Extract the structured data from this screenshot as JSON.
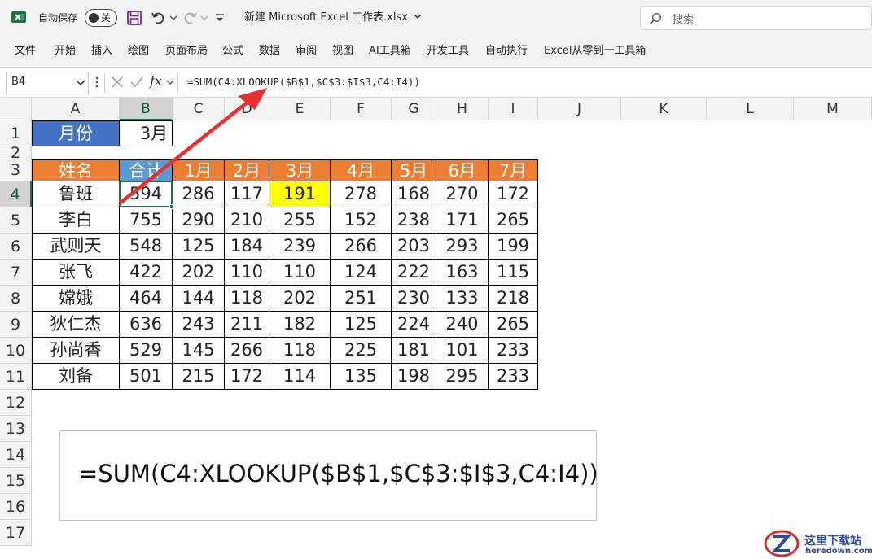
{
  "titlebar": {
    "autosave_label": "自动保存",
    "autosave_state": "关",
    "file_title": "新建 Microsoft Excel 工作表.xlsx",
    "search_placeholder": "搜索"
  },
  "ribbon": {
    "tabs": [
      "文件",
      "开始",
      "插入",
      "绘图",
      "页面布局",
      "公式",
      "数据",
      "审阅",
      "视图",
      "AI工具箱",
      "开发工具",
      "自动执行",
      "Excel从零到一工具箱"
    ]
  },
  "formula_bar": {
    "name_box": "B4",
    "fx_label": "fx",
    "formula": "=SUM(C4:XLOOKUP($B$1,$C$3:$I$3,C4:I4))"
  },
  "sheet": {
    "columns": [
      "A",
      "B",
      "C",
      "D",
      "E",
      "F",
      "G",
      "H",
      "I",
      "J",
      "K",
      "L",
      "M"
    ],
    "rows": [
      "1",
      "2",
      "3",
      "4",
      "5",
      "6",
      "7",
      "8",
      "9",
      "10",
      "11",
      "12",
      "13",
      "14",
      "15",
      "16",
      "17"
    ],
    "selected_cell": "B4",
    "month_label": "月份",
    "month_value": "3月",
    "table_headers": [
      "姓名",
      "合计",
      "1月",
      "2月",
      "3月",
      "4月",
      "5月",
      "6月",
      "7月"
    ],
    "table_rows": [
      [
        "鲁班",
        "594",
        "286",
        "117",
        "191",
        "278",
        "168",
        "270",
        "172"
      ],
      [
        "李白",
        "755",
        "290",
        "210",
        "255",
        "152",
        "238",
        "171",
        "265"
      ],
      [
        "武则天",
        "548",
        "125",
        "184",
        "239",
        "266",
        "203",
        "293",
        "199"
      ],
      [
        "张飞",
        "422",
        "202",
        "110",
        "110",
        "124",
        "222",
        "163",
        "115"
      ],
      [
        "嫦娥",
        "464",
        "144",
        "118",
        "202",
        "251",
        "230",
        "133",
        "218"
      ],
      [
        "狄仁杰",
        "636",
        "243",
        "211",
        "182",
        "125",
        "224",
        "240",
        "265"
      ],
      [
        "孙尚香",
        "529",
        "145",
        "266",
        "118",
        "225",
        "181",
        "101",
        "233"
      ],
      [
        "刘备",
        "501",
        "215",
        "172",
        "114",
        "135",
        "198",
        "295",
        "233"
      ]
    ],
    "formula_callout": "=SUM(C4:XLOOKUP($B$1,$C$3:$I$3,C4:I4))"
  },
  "colors": {
    "header_orange": "#ed7d31",
    "header_blue": "#5b9bd5",
    "month_label_blue": "#4472c4",
    "highlight_yellow": "#ffff00",
    "selection_green": "#217346",
    "arrow_red": "#e8312f"
  },
  "watermark": {
    "cn": "这里下载站",
    "en": "heredown.com"
  }
}
